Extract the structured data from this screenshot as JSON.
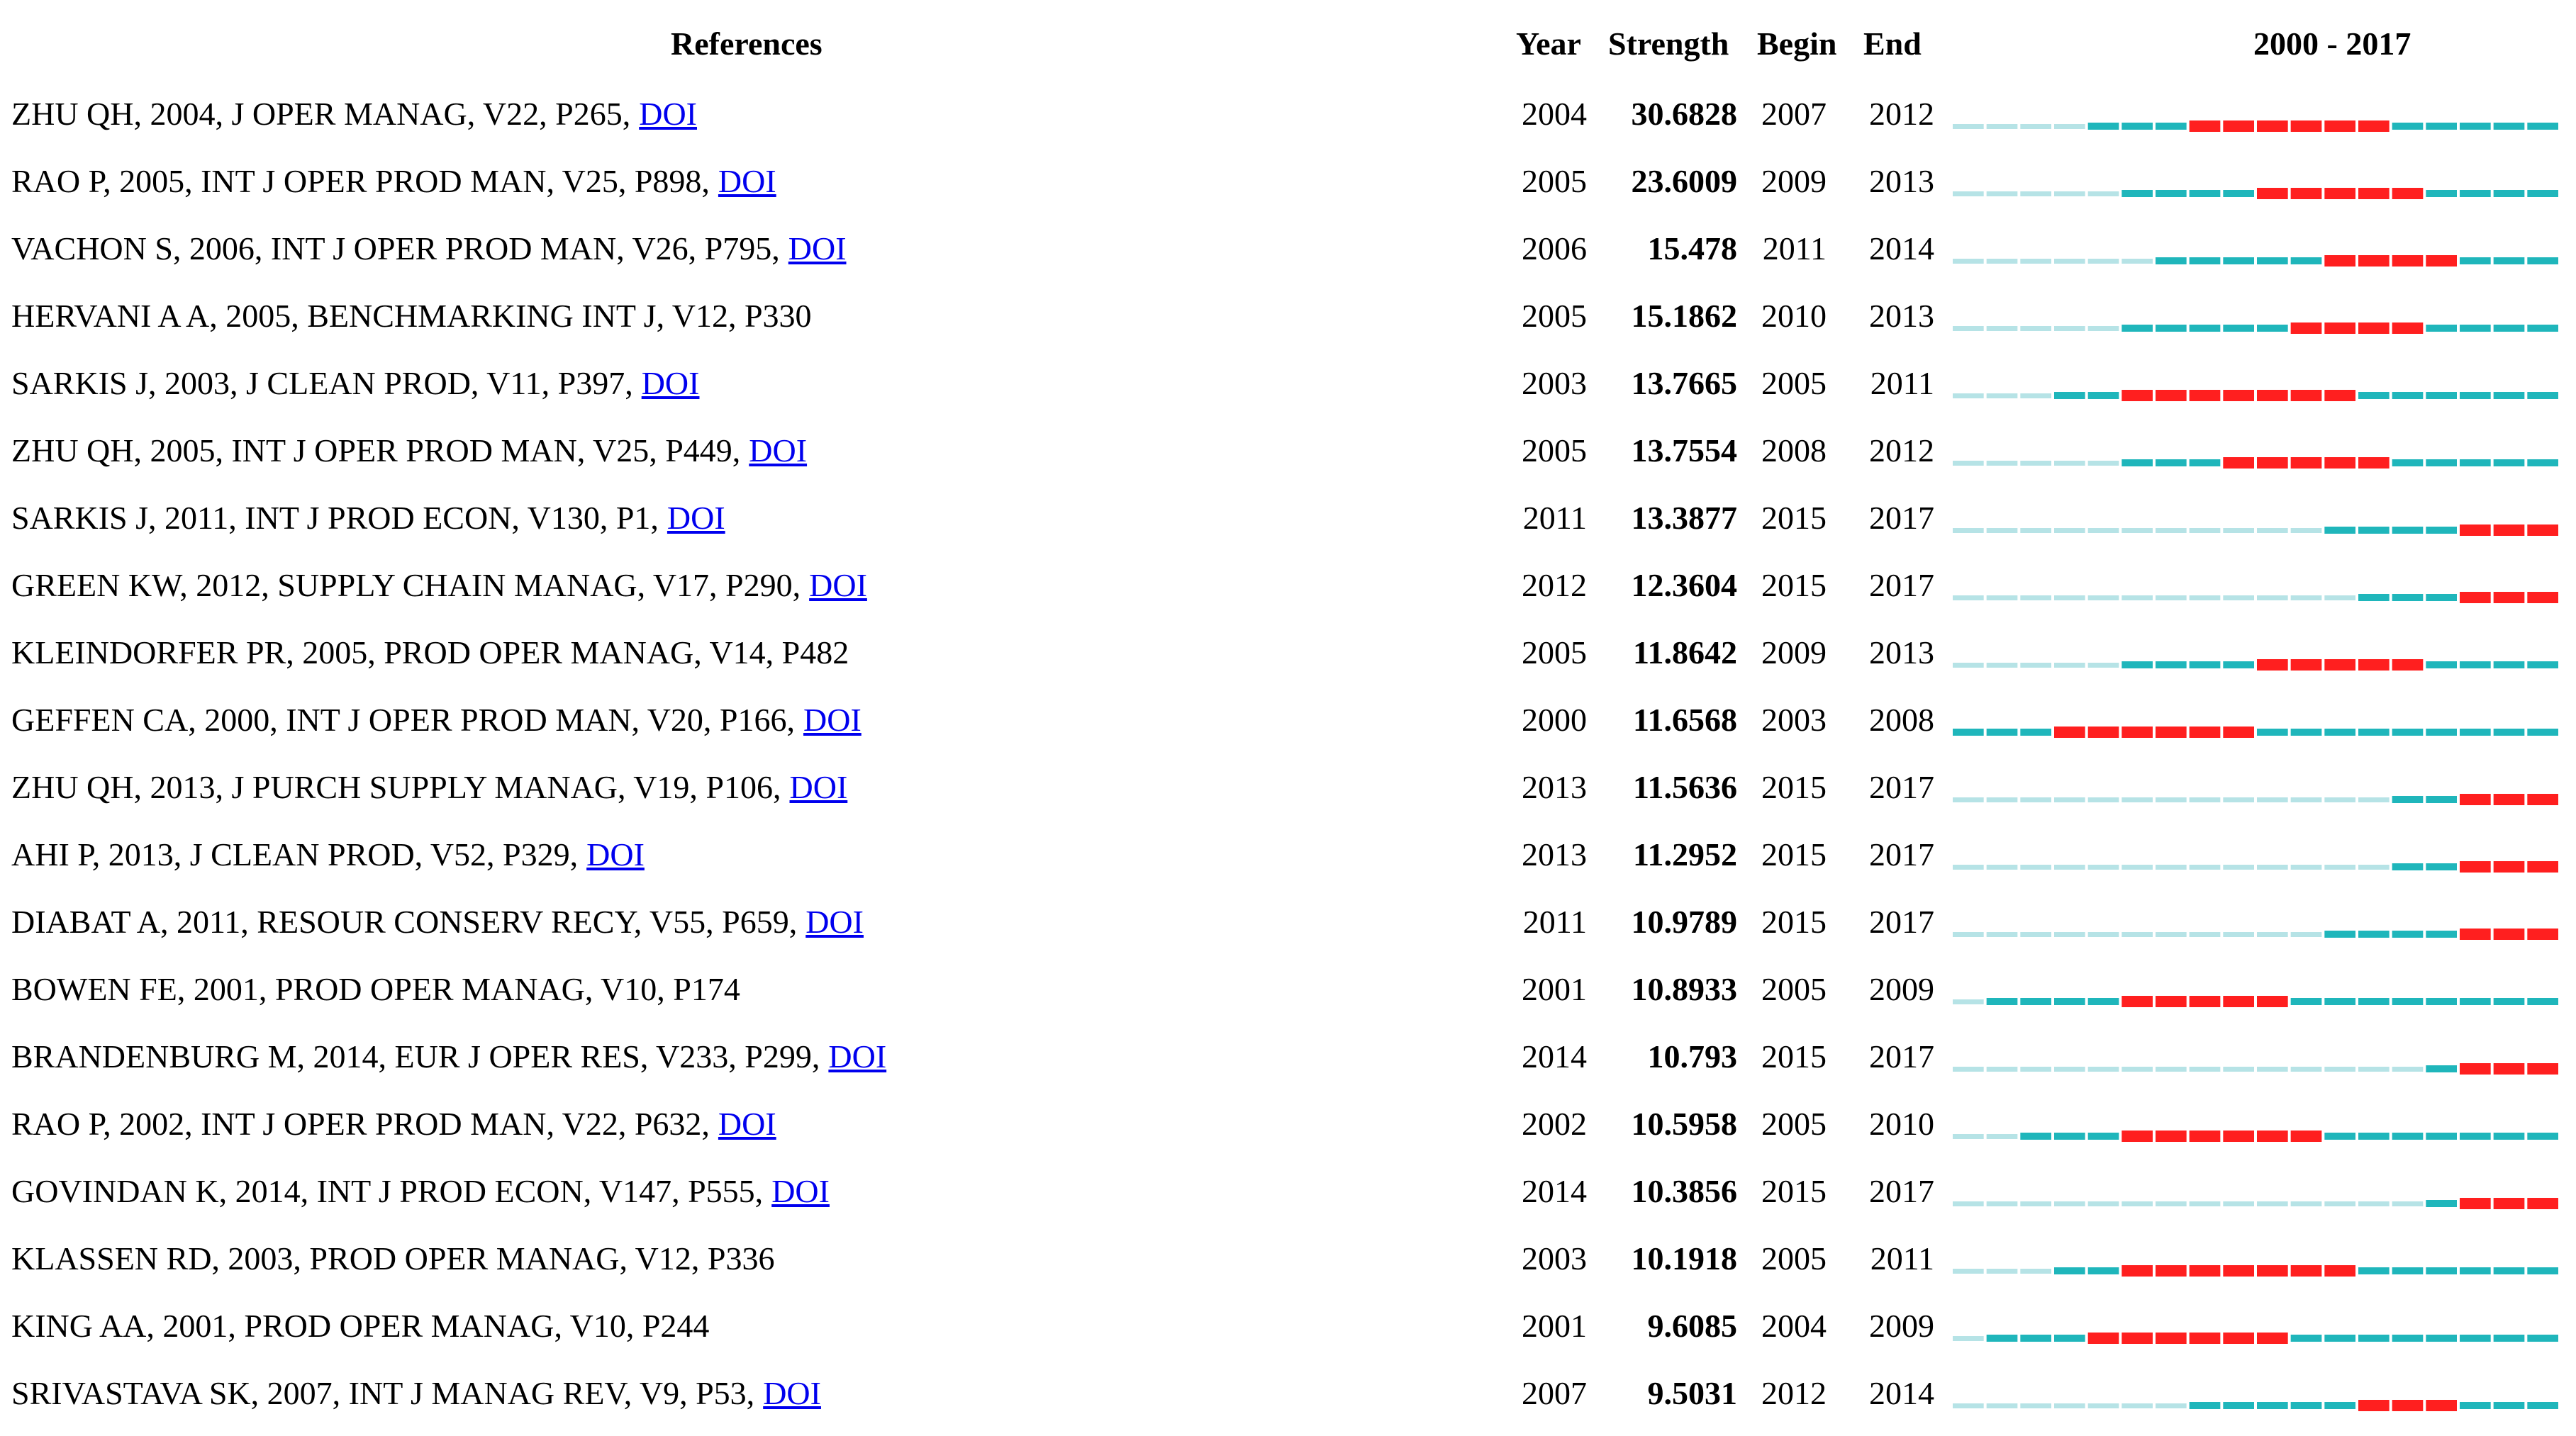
{
  "header": {
    "references": "References",
    "year": "Year",
    "strength": "Strength",
    "begin": "Begin",
    "end": "End",
    "range": "2000 - 2017"
  },
  "colors": {
    "before_publication": "#b6e3e6",
    "active": "#1fb6bb",
    "burst": "#ff1f1f",
    "link": "#0000ee"
  },
  "chart_data": {
    "type": "table",
    "timeline_start": 2000,
    "timeline_end": 2017,
    "columns": [
      "References",
      "Year",
      "Strength",
      "Begin",
      "End",
      "2000 - 2017"
    ],
    "rows": [
      {
        "ref": "ZHU QH, 2004, J OPER MANAG, V22, P265,",
        "doi": "DOI",
        "year": 2004,
        "strength": "30.6828",
        "begin": 2007,
        "end": 2012
      },
      {
        "ref": "RAO P, 2005, INT J OPER PROD MAN, V25, P898,",
        "doi": "DOI",
        "year": 2005,
        "strength": "23.6009",
        "begin": 2009,
        "end": 2013
      },
      {
        "ref": "VACHON S, 2006, INT J OPER PROD MAN, V26, P795,",
        "doi": "DOI",
        "year": 2006,
        "strength": "15.478",
        "begin": 2011,
        "end": 2014
      },
      {
        "ref": "HERVANI A A, 2005, BENCHMARKING INT J, V12, P330",
        "doi": "",
        "year": 2005,
        "strength": "15.1862",
        "begin": 2010,
        "end": 2013
      },
      {
        "ref": "SARKIS J, 2003, J CLEAN PROD, V11, P397,",
        "doi": "DOI",
        "year": 2003,
        "strength": "13.7665",
        "begin": 2005,
        "end": 2011
      },
      {
        "ref": "ZHU QH, 2005, INT J OPER PROD MAN, V25, P449,",
        "doi": "DOI",
        "year": 2005,
        "strength": "13.7554",
        "begin": 2008,
        "end": 2012
      },
      {
        "ref": "SARKIS J, 2011, INT J PROD ECON, V130, P1,",
        "doi": "DOI",
        "year": 2011,
        "strength": "13.3877",
        "begin": 2015,
        "end": 2017
      },
      {
        "ref": "GREEN KW, 2012, SUPPLY CHAIN MANAG, V17, P290,",
        "doi": "DOI",
        "year": 2012,
        "strength": "12.3604",
        "begin": 2015,
        "end": 2017
      },
      {
        "ref": "KLEINDORFER PR, 2005, PROD OPER MANAG, V14, P482",
        "doi": "",
        "year": 2005,
        "strength": "11.8642",
        "begin": 2009,
        "end": 2013
      },
      {
        "ref": "GEFFEN CA, 2000, INT J OPER PROD MAN, V20, P166,",
        "doi": "DOI",
        "year": 2000,
        "strength": "11.6568",
        "begin": 2003,
        "end": 2008
      },
      {
        "ref": "ZHU QH, 2013, J PURCH SUPPLY MANAG, V19, P106,",
        "doi": "DOI",
        "year": 2013,
        "strength": "11.5636",
        "begin": 2015,
        "end": 2017
      },
      {
        "ref": "AHI P, 2013, J CLEAN PROD, V52, P329,",
        "doi": "DOI",
        "year": 2013,
        "strength": "11.2952",
        "begin": 2015,
        "end": 2017
      },
      {
        "ref": "DIABAT A, 2011, RESOUR CONSERV RECY, V55, P659,",
        "doi": "DOI",
        "year": 2011,
        "strength": "10.9789",
        "begin": 2015,
        "end": 2017
      },
      {
        "ref": "BOWEN FE, 2001, PROD OPER MANAG, V10, P174",
        "doi": "",
        "year": 2001,
        "strength": "10.8933",
        "begin": 2005,
        "end": 2009
      },
      {
        "ref": "BRANDENBURG M, 2014, EUR J OPER RES, V233, P299,",
        "doi": "DOI",
        "year": 2014,
        "strength": "10.793",
        "begin": 2015,
        "end": 2017
      },
      {
        "ref": "RAO P, 2002, INT J OPER PROD MAN, V22, P632,",
        "doi": "DOI",
        "year": 2002,
        "strength": "10.5958",
        "begin": 2005,
        "end": 2010
      },
      {
        "ref": "GOVINDAN K, 2014, INT J PROD ECON, V147, P555,",
        "doi": "DOI",
        "year": 2014,
        "strength": "10.3856",
        "begin": 2015,
        "end": 2017
      },
      {
        "ref": "KLASSEN RD, 2003, PROD OPER MANAG, V12, P336",
        "doi": "",
        "year": 2003,
        "strength": "10.1918",
        "begin": 2005,
        "end": 2011
      },
      {
        "ref": "KING AA, 2001, PROD OPER MANAG, V10, P244",
        "doi": "",
        "year": 2001,
        "strength": "9.6085",
        "begin": 2004,
        "end": 2009
      },
      {
        "ref": "SRIVASTAVA SK, 2007, INT J MANAG REV, V9, P53,",
        "doi": "DOI",
        "year": 2007,
        "strength": "9.5031",
        "begin": 2012,
        "end": 2014
      }
    ]
  }
}
